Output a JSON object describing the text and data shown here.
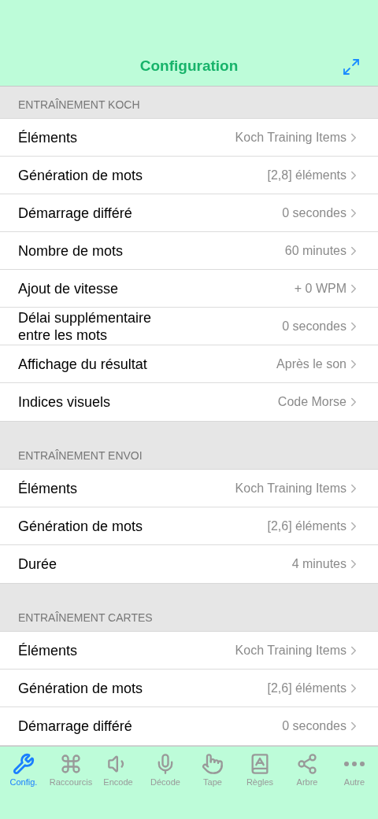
{
  "header": {
    "title": "Configuration"
  },
  "sections": [
    {
      "title": "ENTRAÎNEMENT KOCH",
      "rows": [
        {
          "label": "Éléments",
          "value": "Koch Training Items"
        },
        {
          "label": "Génération de mots",
          "value": "[2,8] éléments"
        },
        {
          "label": "Démarrage différé",
          "value": "0 secondes"
        },
        {
          "label": "Nombre de mots",
          "value": "60 minutes"
        },
        {
          "label": "Ajout de vitesse",
          "value": "+ 0 WPM"
        },
        {
          "label": "Délai supplémentaire entre les mots",
          "value": "0 secondes"
        },
        {
          "label": "Affichage du résultat",
          "value": "Après le son"
        },
        {
          "label": "Indices visuels",
          "value": "Code Morse"
        }
      ]
    },
    {
      "title": "ENTRAÎNEMENT ENVOI",
      "rows": [
        {
          "label": "Éléments",
          "value": "Koch Training Items"
        },
        {
          "label": "Génération de mots",
          "value": "[2,6] éléments"
        },
        {
          "label": "Durée",
          "value": "4 minutes"
        }
      ]
    },
    {
      "title": "ENTRAÎNEMENT CARTES",
      "rows": [
        {
          "label": "Éléments",
          "value": "Koch Training Items"
        },
        {
          "label": "Génération de mots",
          "value": "[2,6] éléments"
        },
        {
          "label": "Démarrage différé",
          "value": "0 secondes"
        }
      ]
    }
  ],
  "tabs": [
    {
      "kind": "tools",
      "label": "Config.",
      "selected": true
    },
    {
      "kind": "command",
      "label": "Raccourcis",
      "selected": false
    },
    {
      "kind": "speaker",
      "label": "Encode",
      "selected": false
    },
    {
      "kind": "mic",
      "label": "Décode",
      "selected": false
    },
    {
      "kind": "hand",
      "label": "Tape",
      "selected": false
    },
    {
      "kind": "book",
      "label": "Règles",
      "selected": false
    },
    {
      "kind": "share",
      "label": "Arbre",
      "selected": false
    },
    {
      "kind": "more",
      "label": "Autre",
      "selected": false
    }
  ]
}
